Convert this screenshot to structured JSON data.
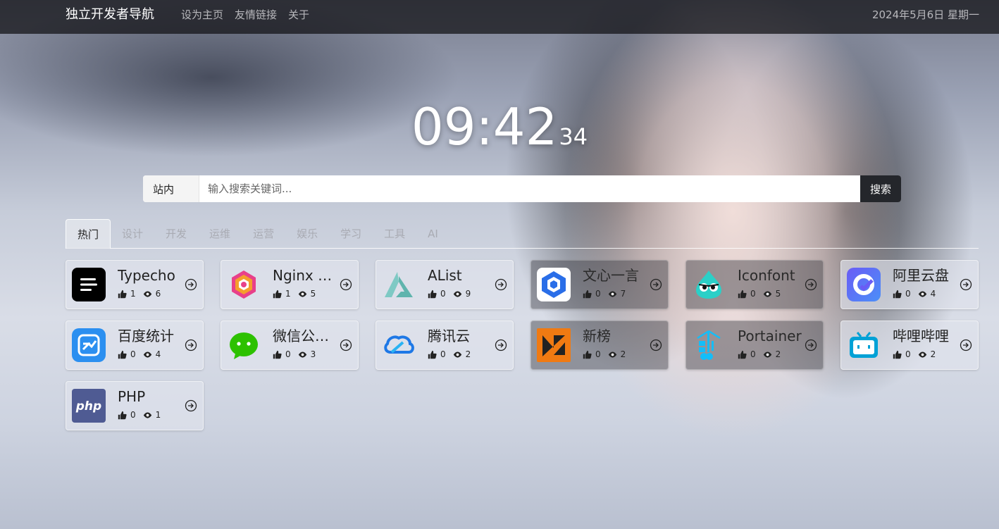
{
  "header": {
    "brand": "独立开发者导航",
    "nav": [
      "设为主页",
      "友情链接",
      "关于"
    ],
    "date": "2024年5月6日 星期一"
  },
  "clock": {
    "hm": "09:42",
    "sec": "34"
  },
  "search": {
    "scope": "站内",
    "placeholder": "输入搜索关键词...",
    "button": "搜索"
  },
  "tabs": [
    "热门",
    "设计",
    "开发",
    "运维",
    "运营",
    "娱乐",
    "学习",
    "工具",
    "AI"
  ],
  "active_tab": "热门",
  "cards": [
    {
      "name": "Typecho",
      "likes": "1",
      "views": "6",
      "icon": "typecho-logo"
    },
    {
      "name": "Nginx P...",
      "likes": "1",
      "views": "5",
      "icon": "nginx-proxy-logo"
    },
    {
      "name": "AList",
      "likes": "0",
      "views": "9",
      "icon": "alist-logo"
    },
    {
      "name": "文心一言",
      "likes": "0",
      "views": "7",
      "icon": "wenxin-logo"
    },
    {
      "name": "Iconfont",
      "likes": "0",
      "views": "5",
      "icon": "iconfont-logo"
    },
    {
      "name": "阿里云盘",
      "likes": "0",
      "views": "4",
      "icon": "aliyun-drive-logo"
    },
    {
      "name": "百度统计",
      "likes": "0",
      "views": "4",
      "icon": "baidu-tongji-logo"
    },
    {
      "name": "微信公众...",
      "likes": "0",
      "views": "3",
      "icon": "wechat-logo"
    },
    {
      "name": "腾讯云",
      "likes": "0",
      "views": "2",
      "icon": "tencent-cloud-logo"
    },
    {
      "name": "新榜",
      "likes": "0",
      "views": "2",
      "icon": "xinbang-logo"
    },
    {
      "name": "Portainer",
      "likes": "0",
      "views": "2",
      "icon": "portainer-logo"
    },
    {
      "name": "哔哩哔哩",
      "likes": "0",
      "views": "2",
      "icon": "bilibili-logo"
    },
    {
      "name": "PHP",
      "likes": "0",
      "views": "1",
      "icon": "php-logo"
    }
  ]
}
